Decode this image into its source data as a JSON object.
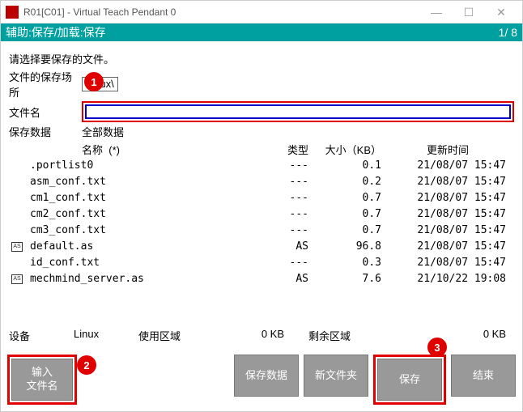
{
  "window": {
    "title": "R01[C01] - Virtual Teach Pendant 0",
    "min": "—",
    "max": "☐",
    "close": "✕"
  },
  "subheader": {
    "left": "辅助:保存/加载:保存",
    "right": "1/ 8"
  },
  "prompt": "请选择要保存的文件。",
  "labels": {
    "location": "文件的保存场所",
    "location_val": "Linux\\",
    "filename": "文件名",
    "savedata": "保存数据",
    "savedata_val": "全部数据"
  },
  "filename_value": "",
  "cols": {
    "name": "名称",
    "star": "(*)",
    "type": "类型",
    "size": "大小（KB）",
    "date": "更新时间"
  },
  "files": [
    {
      "icon": "",
      "name": ".portlist0",
      "type": "---",
      "size": "0.1",
      "date": "21/08/07 15:47"
    },
    {
      "icon": "",
      "name": "asm_conf.txt",
      "type": "---",
      "size": "0.2",
      "date": "21/08/07 15:47"
    },
    {
      "icon": "",
      "name": "cm1_conf.txt",
      "type": "---",
      "size": "0.7",
      "date": "21/08/07 15:47"
    },
    {
      "icon": "",
      "name": "cm2_conf.txt",
      "type": "---",
      "size": "0.7",
      "date": "21/08/07 15:47"
    },
    {
      "icon": "",
      "name": "cm3_conf.txt",
      "type": "---",
      "size": "0.7",
      "date": "21/08/07 15:47"
    },
    {
      "icon": "AS",
      "name": "default.as",
      "type": "AS",
      "size": "96.8",
      "date": "21/08/07 15:47"
    },
    {
      "icon": "",
      "name": "id_conf.txt",
      "type": "---",
      "size": "0.3",
      "date": "21/08/07 15:47"
    },
    {
      "icon": "AS",
      "name": "mechmind_server.as",
      "type": "AS",
      "size": "7.6",
      "date": "21/10/22 19:08"
    }
  ],
  "status": {
    "device_lbl": "设备",
    "device_val": "Linux",
    "used_lbl": "使用区域",
    "used_val": "0 KB",
    "free_lbl": "剩余区域",
    "free_val": "0 KB"
  },
  "buttons": {
    "input_filename": "输入\n文件名",
    "save_data": "保存数据",
    "new_folder": "新文件夹",
    "save": "保存",
    "end": "结束"
  },
  "badges": {
    "b1": "1",
    "b2": "2",
    "b3": "3"
  }
}
